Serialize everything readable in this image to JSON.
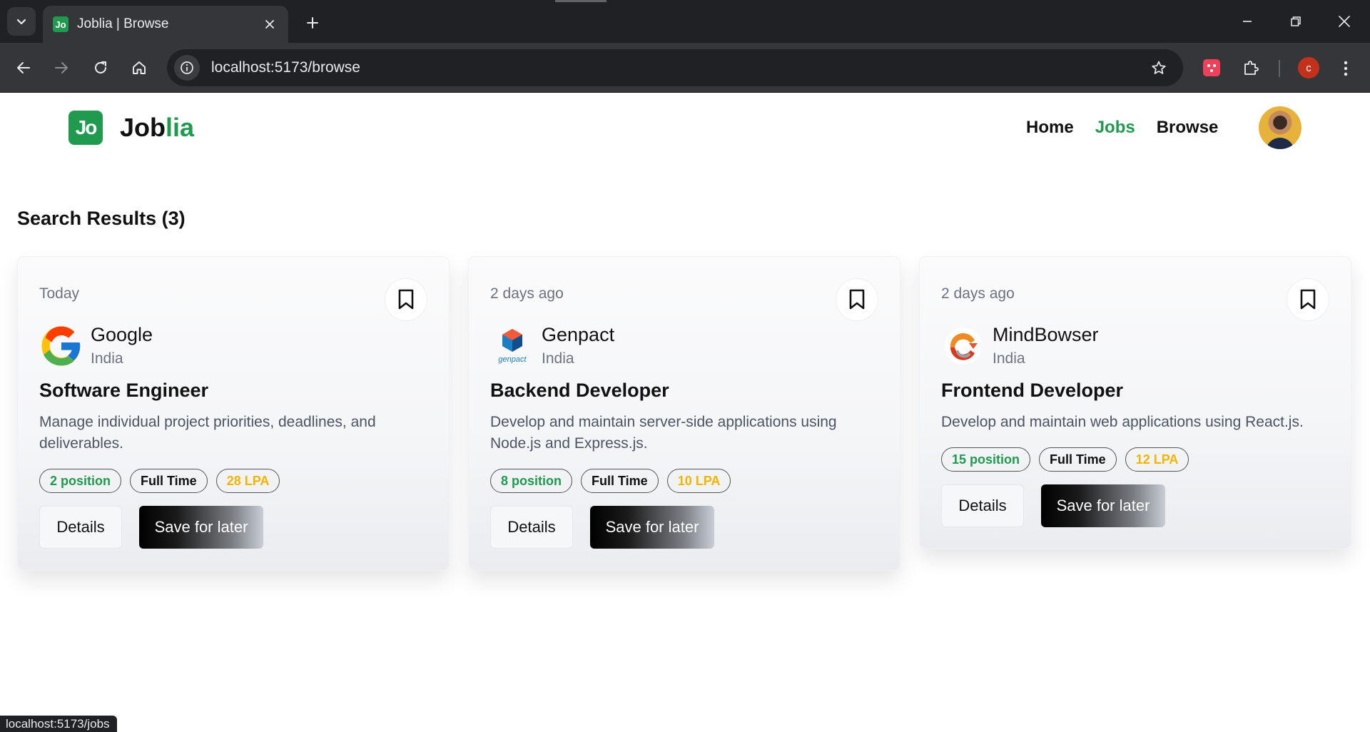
{
  "browser": {
    "tab_title": "Joblia | Browse",
    "favicon_text": "Jo",
    "url": "localhost:5173/browse",
    "profile_initial": "c",
    "status_url": "localhost:5173/jobs"
  },
  "header": {
    "logo_text": "Jo",
    "brand_prefix": "Job",
    "brand_suffix": "lia",
    "nav": [
      {
        "label": "Home",
        "active": false
      },
      {
        "label": "Jobs",
        "active": true
      },
      {
        "label": "Browse",
        "active": false
      }
    ]
  },
  "results": {
    "title": "Search Results (3)"
  },
  "jobs": [
    {
      "posted": "Today",
      "company": "Google",
      "location": "India",
      "title": "Software Engineer",
      "description": "Manage individual project priorities, deadlines, and deliverables.",
      "positions": "2 position",
      "job_type": "Full Time",
      "salary": "28 LPA",
      "details_label": "Details",
      "save_label": "Save for later",
      "logo": "google-logo"
    },
    {
      "posted": "2 days ago",
      "company": "Genpact",
      "location": "India",
      "title": "Backend Developer",
      "description": "Develop and maintain server-side applications using Node.js and Express.js.",
      "positions": "8 position",
      "job_type": "Full Time",
      "salary": "10 LPA",
      "details_label": "Details",
      "save_label": "Save for later",
      "logo": "genpact-logo",
      "logo_text": "genpact"
    },
    {
      "posted": "2 days ago",
      "company": "MindBowser",
      "location": "India",
      "title": "Frontend Developer",
      "description": "Develop and maintain web applications using React.js.",
      "positions": "15 position",
      "job_type": "Full Time",
      "salary": "12 LPA",
      "details_label": "Details",
      "save_label": "Save for later",
      "logo": "mindbowser-logo"
    }
  ],
  "colors": {
    "brand_green": "#1f9a4f",
    "salary_gold": "#f4b400",
    "chrome_dark": "#202124",
    "chrome_toolbar": "#35363a"
  }
}
